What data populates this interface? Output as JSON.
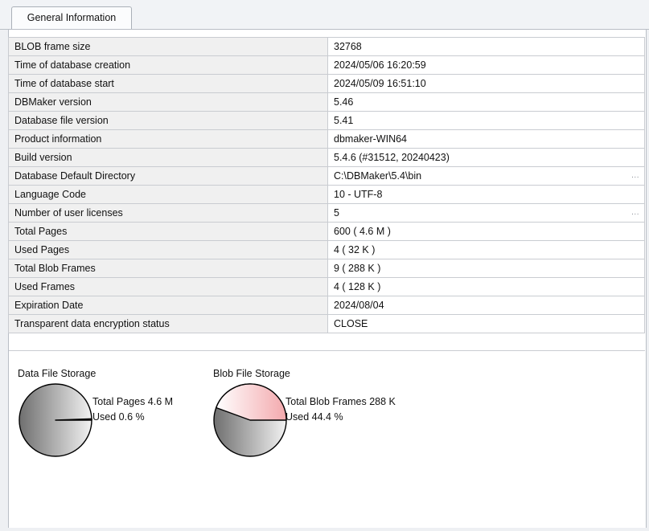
{
  "tabs": [
    {
      "label": "General Information",
      "active": true
    }
  ],
  "info_rows": [
    {
      "key": "BLOB frame size",
      "value": "32768",
      "has_button": false
    },
    {
      "key": "Time of database creation",
      "value": "2024/05/06 16:20:59",
      "has_button": false
    },
    {
      "key": "Time of database start",
      "value": "2024/05/09 16:51:10",
      "has_button": false
    },
    {
      "key": "DBMaker version",
      "value": "5.46",
      "has_button": false
    },
    {
      "key": "Database file version",
      "value": "5.41",
      "has_button": false
    },
    {
      "key": "Product information",
      "value": "dbmaker-WIN64",
      "has_button": false
    },
    {
      "key": "Build version",
      "value": "5.4.6 (#31512, 20240423)",
      "has_button": false
    },
    {
      "key": "Database Default Directory",
      "value": "C:\\DBMaker\\5.4\\bin",
      "has_button": true
    },
    {
      "key": "Language Code",
      "value": "10 - UTF-8",
      "has_button": false
    },
    {
      "key": "Number of user licenses",
      "value": "5",
      "has_button": true
    },
    {
      "key": "Total Pages",
      "value": "600 ( 4.6 M )",
      "has_button": false
    },
    {
      "key": "Used Pages",
      "value": "4 ( 32 K )",
      "has_button": false
    },
    {
      "key": "Total Blob Frames",
      "value": "9 ( 288 K )",
      "has_button": false
    },
    {
      "key": "Used Frames",
      "value": "4 ( 128 K )",
      "has_button": false
    },
    {
      "key": "Expiration Date",
      "value": "2024/08/04",
      "has_button": false
    },
    {
      "key": "Transparent data encryption status",
      "value": "CLOSE",
      "has_button": false
    }
  ],
  "row_button_label": "...",
  "storage": {
    "data_file": {
      "title": "Data File Storage",
      "total_label": "Total Pages 4.6 M",
      "used_label": "Used 0.6 %",
      "used_fraction": 0.006
    },
    "blob_file": {
      "title": "Blob File Storage",
      "total_label": "Total Blob Frames 288 K",
      "used_label": "Used 44.4 %",
      "used_fraction": 0.444
    }
  }
}
